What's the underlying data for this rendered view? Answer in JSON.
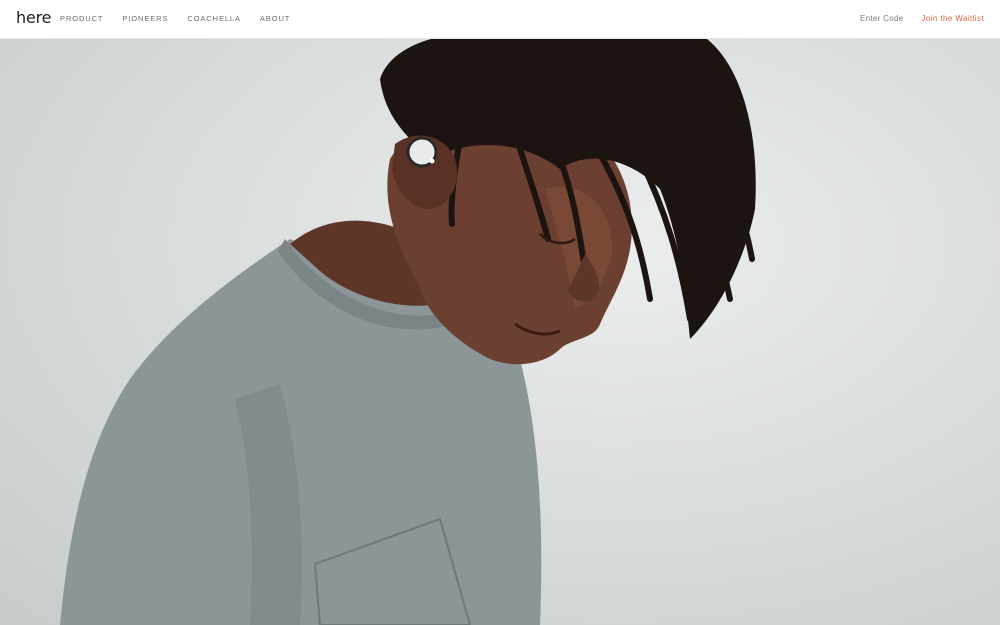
{
  "header": {
    "logo": "here",
    "nav": [
      "PRODUCT",
      "PIONEERS",
      "COACHELLA",
      "ABOUT"
    ],
    "enter_code": "Enter Code",
    "join_waitlist": "Join the Waitlist"
  },
  "hero": {
    "image_subject": "person-wearing-wireless-earbud",
    "colors": {
      "background": "#d5d8d8",
      "shirt": "#8c9699",
      "skin": "#6b4030",
      "hair": "#1c1410",
      "earbud": "#e9eaea",
      "accent": "#d9643f"
    }
  }
}
